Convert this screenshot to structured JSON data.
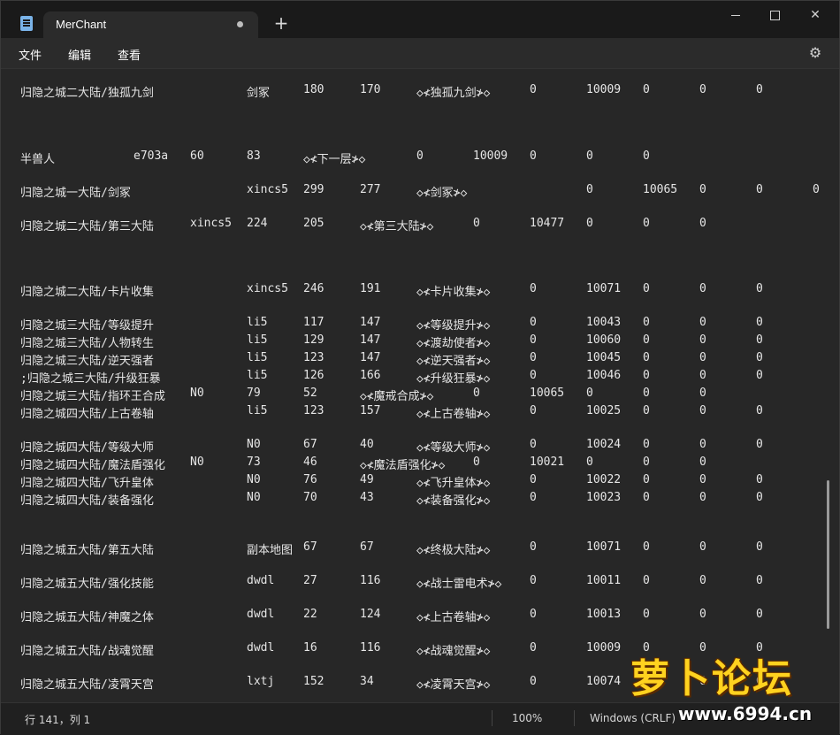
{
  "window": {
    "tab_title": "MerChant",
    "new_tab_symbol": "+",
    "close_symbol": "✕"
  },
  "menu": {
    "file": "文件",
    "edit": "编辑",
    "view": "查看"
  },
  "lines": [
    [
      "归隐之城二大陆/独孤九剑",
      "剑冢",
      "180",
      "170",
      "◇≮独孤九剑≯◇",
      "0",
      "10009",
      "0",
      "0",
      "0"
    ],
    [
      "半兽人",
      "e703a",
      "60",
      "83",
      "◇≮下一层≯◇",
      "0",
      "10009",
      "0",
      "0",
      "0"
    ],
    [
      "归隐之城一大陆/剑冢",
      "xincs5",
      "299",
      "277",
      "◇≮剑冢≯◇",
      "0",
      "10065",
      "0",
      "0",
      "0"
    ],
    [
      "归隐之城二大陆/第三大陆",
      "xincs5",
      "224",
      "205",
      "◇≮第三大陆≯◇",
      "0",
      "10477",
      "0",
      "0",
      "0"
    ],
    [
      "归隐之城二大陆/卡片收集",
      "xincs5",
      "246",
      "191",
      "◇≮卡片收集≯◇",
      "0",
      "10071",
      "0",
      "0",
      "0"
    ],
    [
      "归隐之城三大陆/等级提升",
      "li5",
      "117",
      "147",
      "◇≮等级提升≯◇",
      "0",
      "10043",
      "0",
      "0",
      "0"
    ],
    [
      "归隐之城三大陆/人物转生",
      "li5",
      "129",
      "147",
      "◇≮渡劫使者≯◇",
      "0",
      "10060",
      "0",
      "0",
      "0"
    ],
    [
      "归隐之城三大陆/逆天强者",
      "li5",
      "123",
      "147",
      "◇≮逆天强者≯◇",
      "0",
      "10045",
      "0",
      "0",
      "0"
    ],
    [
      ";归隐之城三大陆/升级狂暴",
      "li5",
      "126",
      "166",
      "◇≮升级狂暴≯◇",
      "0",
      "10046",
      "0",
      "0",
      "0"
    ],
    [
      "归隐之城三大陆/指环王合成",
      "N0",
      "79",
      "52",
      "◇≮魔戒合成≯◇",
      "0",
      "10065",
      "0",
      "0",
      "0"
    ],
    [
      "归隐之城四大陆/上古卷轴",
      "li5",
      "123",
      "157",
      "◇≮上古卷轴≯◇",
      "0",
      "10025",
      "0",
      "0",
      "0"
    ],
    [
      "归隐之城四大陆/等级大师",
      "N0",
      "67",
      "40",
      "◇≮等级大师≯◇",
      "0",
      "10024",
      "0",
      "0",
      "0"
    ],
    [
      "归隐之城四大陆/魔法盾强化",
      "N0",
      "73",
      "46",
      "◇≮魔法盾强化≯◇",
      "0",
      "10021",
      "0",
      "0",
      "0"
    ],
    [
      "归隐之城四大陆/飞升皇体",
      "N0",
      "76",
      "49",
      "◇≮飞升皇体≯◇",
      "0",
      "10022",
      "0",
      "0",
      "0"
    ],
    [
      "归隐之城四大陆/装备强化",
      "N0",
      "70",
      "43",
      "◇≮装备强化≯◇",
      "0",
      "10023",
      "0",
      "0",
      "0"
    ],
    [
      "归隐之城五大陆/第五大陆",
      "副本地图",
      "67",
      "67",
      "◇≮终极大陆≯◇",
      "0",
      "10071",
      "0",
      "0",
      "0"
    ],
    [
      "归隐之城五大陆/强化技能",
      "dwdl",
      "27",
      "116",
      "◇≮战士雷电术≯◇",
      "0",
      "10011",
      "0",
      "0",
      "0"
    ],
    [
      "归隐之城五大陆/神魔之体",
      "dwdl",
      "22",
      "124",
      "◇≮上古卷轴≯◇",
      "0",
      "10013",
      "0",
      "0",
      "0"
    ],
    [
      "归隐之城五大陆/战魂觉醒",
      "dwdl",
      "16",
      "116",
      "◇≮战魂觉醒≯◇",
      "0",
      "10009",
      "0",
      "0",
      "0"
    ],
    [
      "归隐之城五大陆/凌霄天宫",
      "lxtj",
      "152",
      "34",
      "◇≮凌霄天宫≯◇",
      "0",
      "10074",
      "0",
      "0",
      "0"
    ]
  ],
  "status": {
    "position": "行 141，列 1",
    "zoom": "100%",
    "line_ending": "Windows (CRLF)"
  },
  "watermark": {
    "text": "萝卜论坛",
    "url": "www.6994.cn"
  },
  "icons": [
    "notepad-icon",
    "plus-icon",
    "minimize-icon",
    "maximize-icon",
    "close-icon",
    "gear-icon"
  ]
}
